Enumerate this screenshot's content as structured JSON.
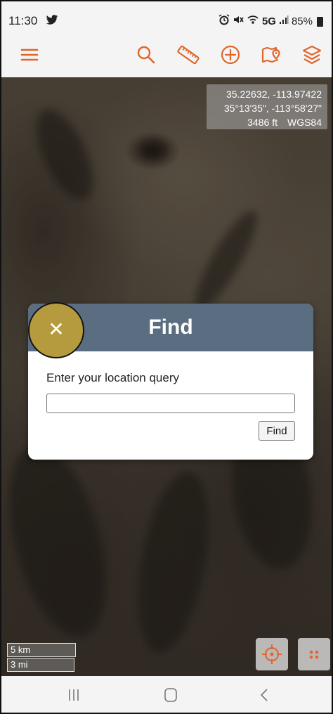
{
  "status_bar": {
    "time": "11:30",
    "network": "5G",
    "battery": "85%",
    "icons": [
      "twitter-icon",
      "alarm-icon",
      "mute-icon",
      "wifi-calling-icon",
      "signal-icon",
      "battery-icon"
    ]
  },
  "toolbar": {
    "accent_color": "#e0662c",
    "items": [
      "menu-icon",
      "search-icon",
      "ruler-icon",
      "add-icon",
      "map-pin-icon",
      "layers-icon"
    ]
  },
  "coordinates": {
    "decimal": "35.22632, -113.97422",
    "dms": "35°13'35\", -113°58'27\"",
    "elevation": "3486 ft",
    "datum": "WGS84"
  },
  "scale": {
    "metric": "5 km",
    "imperial": "3 mi"
  },
  "dialog": {
    "title": "Find",
    "close_symbol": "✕",
    "prompt": "Enter your location query",
    "input_value": "",
    "input_placeholder": "",
    "button_label": "Find",
    "header_color": "#5b6d80",
    "close_highlight_color": "#b59b3e"
  },
  "map_buttons": [
    "locate-icon",
    "more-dots-icon"
  ],
  "nav_bar": [
    "recents-icon",
    "home-icon",
    "back-icon"
  ]
}
